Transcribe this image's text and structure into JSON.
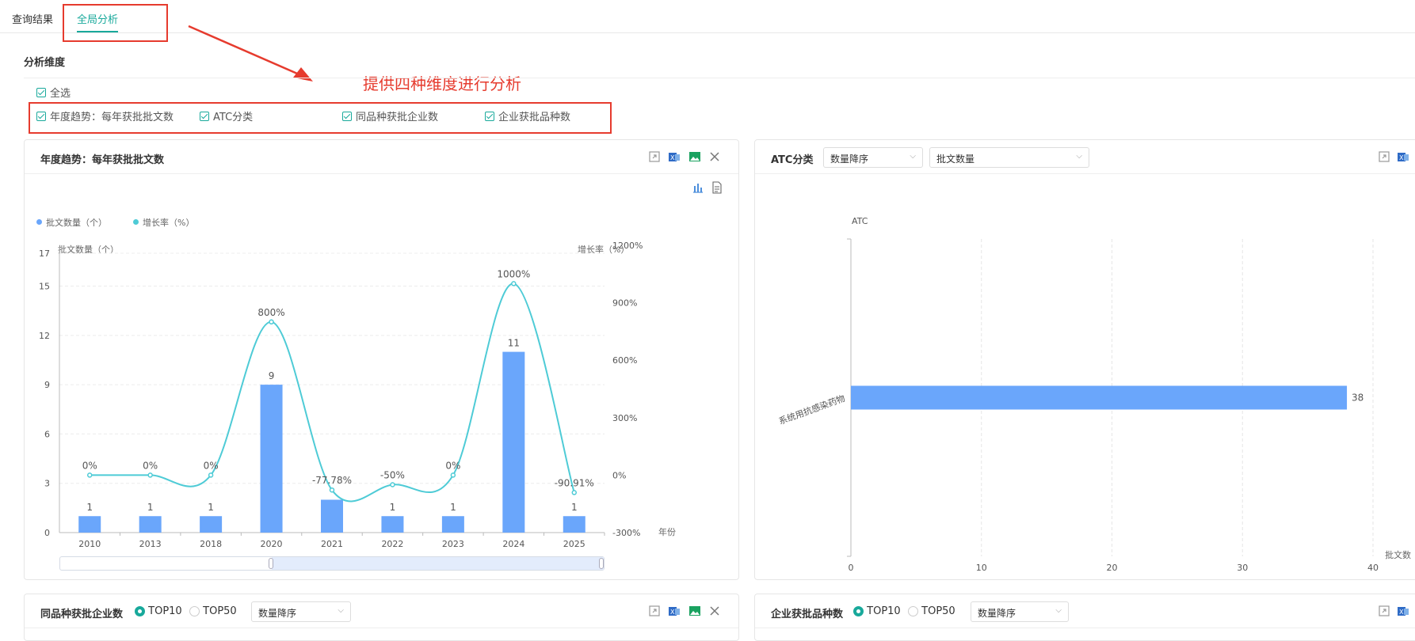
{
  "tabs": [
    {
      "label": "查询结果"
    },
    {
      "label": "全局分析"
    }
  ],
  "analysis": {
    "section_title": "分析维度",
    "select_all": "全选",
    "dimensions": [
      "年度趋势：每年获批批文数",
      "ATC分类",
      "同品种获批企业数",
      "企业获批品种数"
    ],
    "annotation": "提供四种维度进行分析"
  },
  "panel_yearly": {
    "title": "年度趋势：每年获批批文数",
    "legend": [
      "批文数量（个）",
      "增长率（%）"
    ],
    "y_left_label": "批文数量（个）",
    "y_right_label": "增长率（%）",
    "x_axis_label": "年份"
  },
  "panel_atc": {
    "title": "ATC分类",
    "sort_select": "数量降序",
    "metric_select": "批文数量",
    "y_label": "ATC",
    "x_label": "批文数"
  },
  "panel_same_variety": {
    "title": "同品种获批企业数",
    "radio_top10": "TOP10",
    "radio_top50": "TOP50",
    "sort_select": "数量降序"
  },
  "panel_enterprise": {
    "title": "企业获批品种数",
    "radio_top10": "TOP10",
    "radio_top50": "TOP50",
    "sort_select": "数量降序"
  },
  "colors": {
    "accent": "#18a99b",
    "bar": "#6aa6fb",
    "line": "#4ecbd6",
    "annotation": "#e63b2e"
  },
  "chart_data": [
    {
      "type": "bar",
      "title": "年度趋势：每年获批批文数",
      "xlabel": "年份",
      "ylabel": "批文数量（个）",
      "categories": [
        "2010",
        "2013",
        "2018",
        "2020",
        "2021",
        "2022",
        "2023",
        "2024",
        "2025"
      ],
      "ylim": [
        0,
        17
      ],
      "yticks": [
        0,
        3,
        6,
        9,
        12,
        15,
        17
      ],
      "y2label": "增长率（%）",
      "y2lim": [
        -300,
        1200
      ],
      "y2ticks": [
        "-300%",
        "0%",
        "300%",
        "600%",
        "900%",
        "1200%"
      ],
      "series": [
        {
          "name": "批文数量（个）",
          "type": "bar",
          "values": [
            1,
            1,
            1,
            9,
            2,
            1,
            1,
            11,
            1
          ],
          "labels": [
            "1",
            "1",
            "1",
            "9",
            "",
            "1",
            "1",
            "11",
            "1"
          ]
        },
        {
          "name": "增长率（%）",
          "type": "line",
          "axis": "right",
          "values": [
            0,
            0,
            0,
            800,
            -77.78,
            -50,
            0,
            1000,
            -90.91
          ],
          "labels": [
            "0%",
            "0%",
            "0%",
            "800%",
            "-77.78%",
            "-50%",
            "0%",
            "1000%",
            "-90.91%"
          ]
        }
      ],
      "legend": "top-left",
      "grid": true
    },
    {
      "type": "bar",
      "orientation": "horizontal",
      "title": "ATC分类",
      "ylabel": "ATC",
      "xlabel": "批文数",
      "categories": [
        "系统用抗感染药物"
      ],
      "values": [
        38
      ],
      "xlim": [
        0,
        40
      ],
      "xticks": [
        0,
        10,
        20,
        30,
        40
      ],
      "grid": true
    }
  ]
}
